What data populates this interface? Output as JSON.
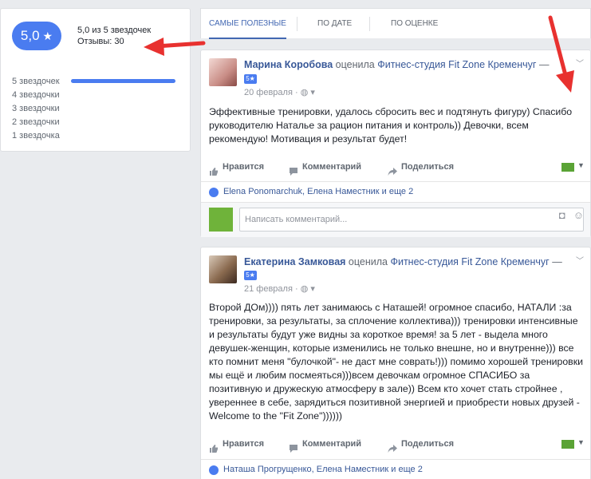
{
  "rating": {
    "score": "5,0",
    "star": "★",
    "summary": "5,0 из 5 звездочек",
    "reviews": "Отзывы: 30",
    "rows": [
      {
        "label": "5 звездочек",
        "fraction": 1.0
      },
      {
        "label": "4 звездочки",
        "fraction": 0
      },
      {
        "label": "3 звездочки",
        "fraction": 0
      },
      {
        "label": "2 звездочки",
        "fraction": 0
      },
      {
        "label": "1 звездочка",
        "fraction": 0
      }
    ]
  },
  "tabs": [
    "САМЫЕ ПОЛЕЗНЫЕ",
    "ПО ДАТЕ",
    "ПО ОЦЕНКЕ"
  ],
  "reviews": [
    {
      "author": "Марина Коробова",
      "verb": "оценила",
      "page": "Фитнес-студия Fit Zone Кременчуг",
      "dash": "—",
      "badge": "5★",
      "date": "20 февраля",
      "date_sep": "·",
      "body": "Эффективные тренировки, удалось сбросить вес и подтянуть фигуру) Спасибо руководителю Наталье за рацион питания и контроль)) Девочки, всем рекомендую! Мотивация и результат будет!",
      "likers": "Elena Ponomarchuk, Елена Наместник и еще 2"
    },
    {
      "author": "Екатерина Замковая",
      "verb": "оценила",
      "page": "Фитнес-студия Fit Zone Кременчуг",
      "dash": "—",
      "badge": "5★",
      "date": "21 февраля",
      "date_sep": "·",
      "body": "Второй ДОм)))) пять лет занимаюсь с Наташей! огромное спасибо, НАТАЛИ :за тренировки, за результаты, за сплочение коллектива))) тренировки интенсивные и результаты будут уже видны за короткое время! за 5 лет - выдела много девушек-женщин, которые изменились не только внешне, но и внутренне))) все кто помнит меня \"булочкой\"- не даст мне соврать!))) помимо хорошей тренировки мы ещё и любим посмеяться)))всем девочкам огромное СПАСИБО за позитивную и дружескую атмосферу в зале)) Всем кто хочет стать стройнее , увереннее в себе, зарядиться позитивной энергией и приобрести новых друзей - Welcome to the \"Fit Zone\"))))))",
      "likers": "Наташа Прогрущенко, Елена Наместник и еще 2"
    }
  ],
  "actions": {
    "like": "Нравится",
    "comment": "Комментарий",
    "share": "Поделиться"
  },
  "comment_placeholder": "Написать комментарий...",
  "colors": {
    "accent": "#4a7cf0",
    "link": "#385898",
    "arrow": "#e8312f"
  }
}
